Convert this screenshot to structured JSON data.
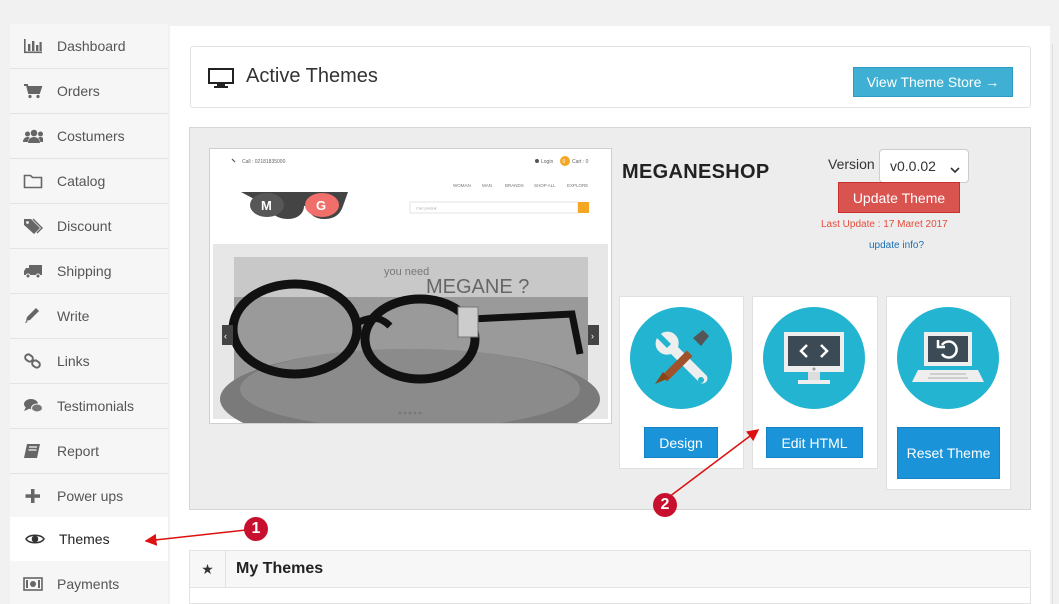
{
  "sidebar": {
    "items": [
      {
        "label": "Dashboard",
        "icon": "bar-chart-icon"
      },
      {
        "label": "Orders",
        "icon": "cart-icon"
      },
      {
        "label": "Costumers",
        "icon": "users-icon"
      },
      {
        "label": "Catalog",
        "icon": "folder-icon"
      },
      {
        "label": "Discount",
        "icon": "tags-icon"
      },
      {
        "label": "Shipping",
        "icon": "truck-icon"
      },
      {
        "label": "Write",
        "icon": "pencil-icon"
      },
      {
        "label": "Links",
        "icon": "link-icon"
      },
      {
        "label": "Testimonials",
        "icon": "comments-icon"
      },
      {
        "label": "Report",
        "icon": "book-icon"
      },
      {
        "label": "Power ups",
        "icon": "plus-icon"
      },
      {
        "label": "Themes",
        "icon": "eye-icon",
        "active": true
      },
      {
        "label": "Payments",
        "icon": "money-icon"
      }
    ]
  },
  "header": {
    "title": "Active Themes",
    "store_button": "View Theme Store →"
  },
  "theme": {
    "name": "MEGANESHOP",
    "version_label": "Version",
    "version_value": "v0.0.02",
    "update_button": "Update Theme",
    "last_update": "Last Update : 17 Maret 2017",
    "update_info": "update info?"
  },
  "preview": {
    "phone": "Call : 02181835000",
    "login": "Login",
    "cart_count": "0",
    "cart_label": "Cart : 0",
    "nav": [
      "WOMAN",
      "MAN",
      "BRANDS",
      "SHOP ALL",
      "EXPLORE"
    ],
    "search_placeholder": "Cari produk",
    "logo_letters": [
      "M",
      "G"
    ],
    "banner_small": "you need",
    "banner_big": "MEGANE ?"
  },
  "actions": {
    "design": "Design",
    "edit_html": "Edit HTML",
    "reset_theme": "Reset Theme"
  },
  "my_themes": {
    "star": "★",
    "title": "My Themes"
  },
  "markers": [
    "1",
    "2"
  ],
  "colors": {
    "accent": "#3fb0d3",
    "danger": "#d9534f",
    "primary_btn": "#1a93d8",
    "circle": "#22b4d0",
    "marker": "#c8102e"
  }
}
